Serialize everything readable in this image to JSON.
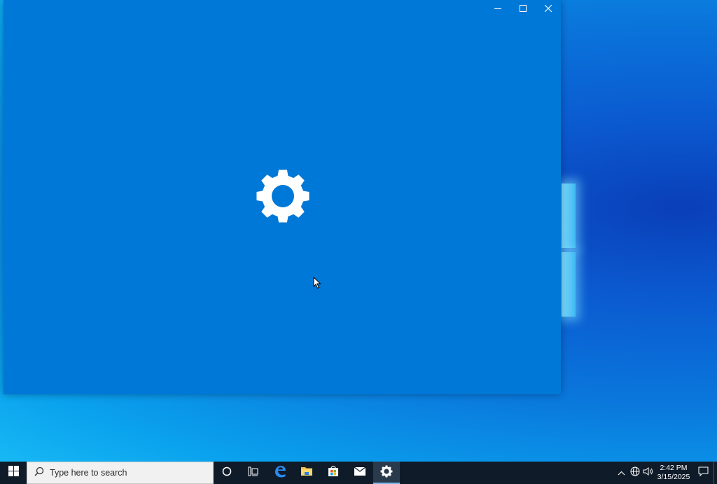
{
  "window": {
    "app": "Settings",
    "state": "loading-splash",
    "background_color": "#0078d7"
  },
  "title_buttons": {
    "minimize_icon": "minimize-icon",
    "maximize_icon": "maximize-icon",
    "close_icon": "close-icon"
  },
  "splash": {
    "icon": "gear-icon",
    "color": "#ffffff"
  },
  "taskbar": {
    "search": {
      "placeholder": "Type here to search"
    },
    "pinned": [
      {
        "name": "cortana",
        "icon": "cortana-circle-icon"
      },
      {
        "name": "task-view",
        "icon": "task-view-icon"
      },
      {
        "name": "edge",
        "icon": "edge-icon"
      },
      {
        "name": "file-explorer",
        "icon": "folder-icon"
      },
      {
        "name": "store",
        "icon": "store-bag-icon"
      },
      {
        "name": "mail",
        "icon": "mail-icon"
      },
      {
        "name": "settings",
        "icon": "gear-icon",
        "active": true
      }
    ],
    "tray": {
      "time": "2:42 PM",
      "date": "3/15/2025"
    }
  }
}
